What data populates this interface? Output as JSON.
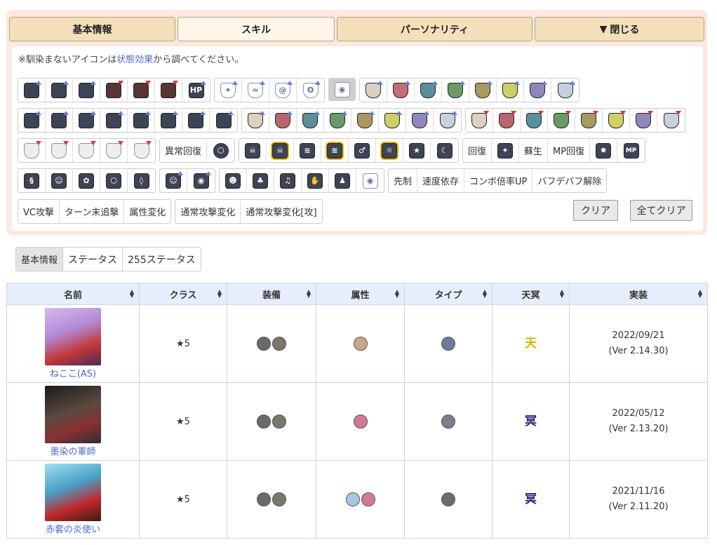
{
  "tabs": [
    "基本情報",
    "スキル",
    "パーソナリティ",
    "閉じる"
  ],
  "note": {
    "prefix": "※馴染まないアイコンは",
    "link": "状態効果",
    "suffix": "から調べてください。"
  },
  "row1": {
    "g1": [
      "atk-up",
      "matk-up",
      "def-up",
      "atk-down",
      "matk-down",
      "def-down",
      "hp-up"
    ],
    "g1_hp": "HP",
    "g2": [
      "element-wind",
      "element-wave",
      "element-swirl",
      "element-vortex"
    ],
    "eye": "eye-icon",
    "g3": [
      "shield-up-fire",
      "shield-up-red",
      "shield-up-teal",
      "shield-up-green",
      "shield-up-gold",
      "shield-up-yellow",
      "shield-up-purple",
      "shield-up-white"
    ]
  },
  "row2": {
    "g1": [
      "res-up-1",
      "res-up-2",
      "res-up-3",
      "res-up-4",
      "res-up-5",
      "res-up-6",
      "res-up-7",
      "res-up-8"
    ],
    "g2": [
      "shield-up-1",
      "shield-up-2",
      "shield-up-3",
      "shield-up-4",
      "shield-up-5",
      "shield-up-6",
      "shield-up-7",
      "shield-up-8"
    ],
    "g3": [
      "shield-down-1",
      "shield-down-2",
      "shield-down-3",
      "shield-down-4",
      "shield-down-5",
      "shield-down-6",
      "shield-down-7",
      "shield-down-8"
    ]
  },
  "row3": {
    "g1": [
      "pierce",
      "slash",
      "moon",
      "arrow",
      "spear"
    ],
    "status_recover": "異常回復",
    "g3": [
      "skull",
      "skull-ring",
      "claw",
      "claw-ring",
      "mars",
      "sun-ring",
      "star",
      "crescent"
    ],
    "heal": "回復",
    "revive": "蘇生",
    "mp_heal": "MP回復",
    "mp_label": "MP"
  },
  "row4": {
    "g1": [
      "spiral",
      "person",
      "flower",
      "hexagon",
      "shield-break"
    ],
    "g2": [
      "person-up",
      "eye-up"
    ],
    "g3": [
      "face",
      "group",
      "dance",
      "hand",
      "ghost",
      "eye"
    ],
    "text": [
      "先制",
      "速度依存",
      "コンボ倍率UP",
      "バフデバフ解除"
    ]
  },
  "row5": {
    "g1": [
      "VC攻撃",
      "ターン末追撃",
      "属性変化"
    ],
    "g2": [
      "通常攻撃変化",
      "通常攻撃変化[攻]"
    ]
  },
  "buttons": {
    "clear": "クリア",
    "clear_all": "全てクリア"
  },
  "subtabs": [
    "基本情報",
    "ステータス",
    "255ステータス"
  ],
  "columns": [
    "名前",
    "クラス",
    "装備",
    "属性",
    "タイプ",
    "天冥",
    "実装"
  ],
  "rows": [
    {
      "name": "ねここ(AS)",
      "class": "★5",
      "tenmei": "天",
      "date": "2022/09/21",
      "ver": "(Ver 2.14.30)",
      "attr_colors": [
        "#c9a88a"
      ],
      "type_color": "#6d7a9a",
      "tm_color": "#d9b400"
    },
    {
      "name": "墨染の軍師",
      "class": "★5",
      "tenmei": "冥",
      "date": "2022/05/12",
      "ver": "(Ver 2.13.20)",
      "attr_colors": [
        "#d07a95"
      ],
      "type_color": "#7a7d8a",
      "tm_color": "#2a2a7a"
    },
    {
      "name": "赤套の炎使い",
      "class": "★5",
      "tenmei": "冥",
      "date": "2021/11/16",
      "ver": "(Ver 2.11.20)",
      "attr_colors": [
        "#aac4e4",
        "#d07a95"
      ],
      "type_color": "#6a6a7a",
      "tm_color": "#2a2a7a"
    }
  ]
}
